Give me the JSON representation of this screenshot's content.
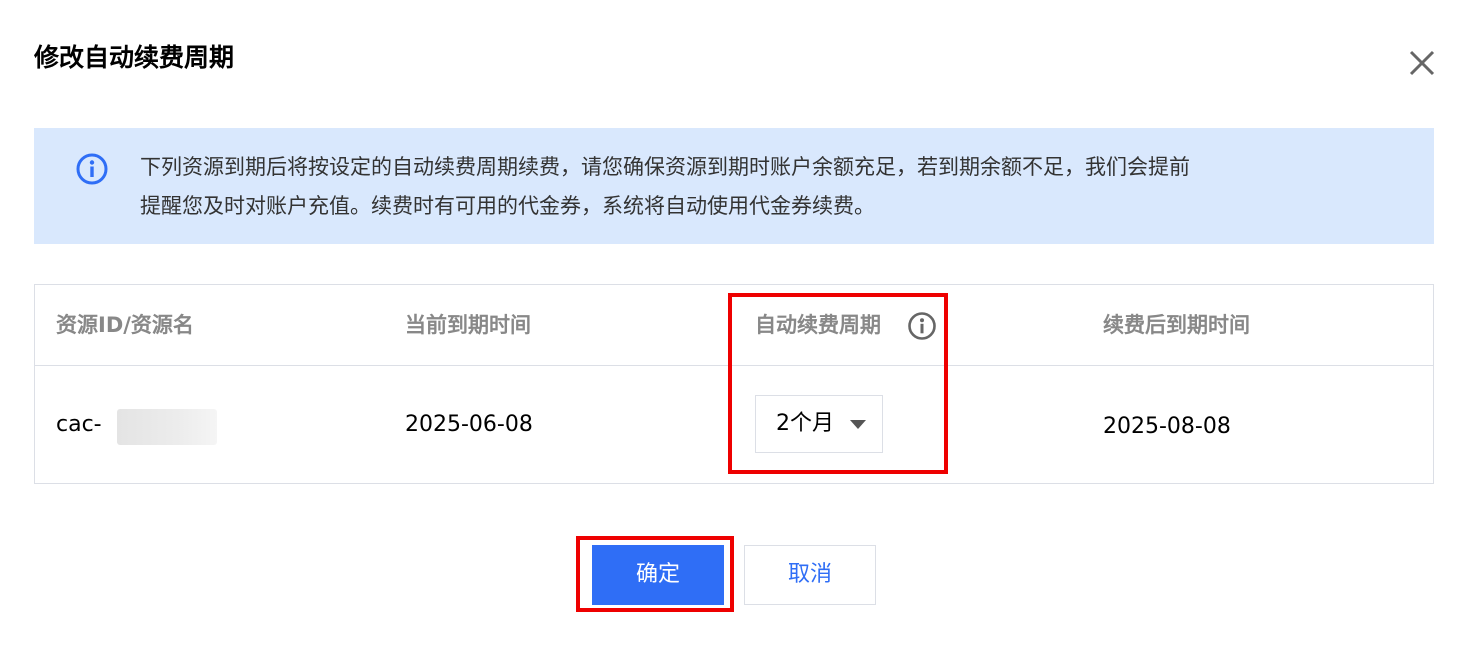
{
  "dialog": {
    "title": "修改自动续费周期",
    "close_icon": "close-icon"
  },
  "notice": {
    "icon": "info-icon",
    "text_line1": "下列资源到期后将按设定的自动续费周期续费，请您确保资源到期时账户余额充足，若到期余额不足，我们会提前",
    "text_line2": "提醒您及时对账户充值。续费时有可用的代金券，系统将自动使用代金券续费。"
  },
  "table": {
    "headers": {
      "resource": "资源ID/资源名",
      "current_expiry": "当前到期时间",
      "renew_period": "自动续费周期",
      "new_expiry": "续费后到期时间"
    },
    "rows": [
      {
        "resource_id": "cac-",
        "current_expiry": "2025-06-08",
        "renew_period": "2个月",
        "new_expiry": "2025-08-08"
      }
    ]
  },
  "buttons": {
    "confirm": "确定",
    "cancel": "取消"
  },
  "colors": {
    "primary": "#2f6ef6",
    "notice_bg": "#d9e8fd",
    "highlight": "#ee0000"
  }
}
